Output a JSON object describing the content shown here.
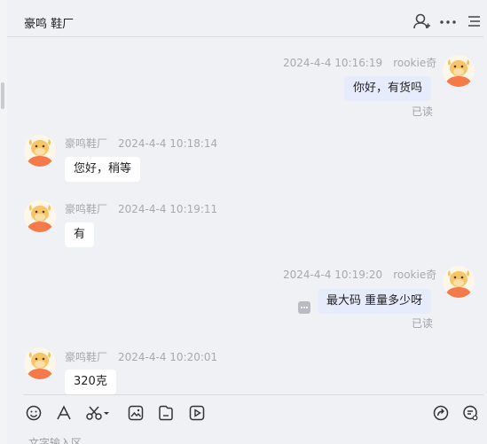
{
  "header": {
    "title": "豪鸣 鞋厂"
  },
  "messages": [
    {
      "sender": "rookie奇",
      "time": "2024-4-4 10:16:19",
      "text": "你好，有货吗",
      "status": "已读"
    },
    {
      "sender": "豪鸣鞋厂",
      "time": "2024-4-4 10:18:14",
      "text": "您好，稍等"
    },
    {
      "sender": "豪鸣鞋厂",
      "time": "2024-4-4 10:19:11",
      "text": "有"
    },
    {
      "sender": "rookie奇",
      "time": "2024-4-4 10:19:20",
      "text": "最大码 重量多少呀",
      "status": "已读"
    },
    {
      "sender": "豪鸣鞋厂",
      "time": "2024-4-4 10:20:01",
      "text": "320克"
    }
  ],
  "input": {
    "placeholder": "文字输入区"
  },
  "colors": {
    "background": "#f0f1f5",
    "outgoing_bubble": "#e6ecfb",
    "incoming_bubble": "#ffffff",
    "avatar_orange": "#f47a4a"
  },
  "icons": {
    "header": [
      "add-user-icon",
      "more-options-icon",
      "menu-icon"
    ],
    "toolbar": [
      "emoji-icon",
      "font-icon",
      "scissors-icon",
      "image-icon",
      "file-icon",
      "video-icon",
      "share-icon",
      "quick-reply-icon"
    ]
  }
}
